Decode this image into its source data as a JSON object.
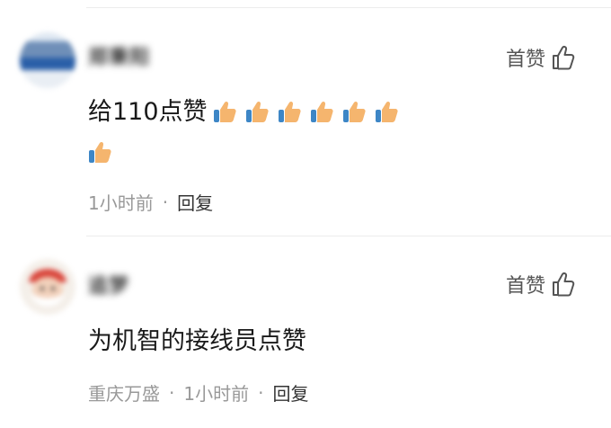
{
  "comments": [
    {
      "username": "郑秉阳",
      "like_label": "首赞",
      "text": "给110点赞",
      "emoji_count": 7,
      "time": "1小时前",
      "dot": "·",
      "reply_label": "回复"
    },
    {
      "username": "追梦",
      "like_label": "首赞",
      "text": "为机智的接线员点赞",
      "location": "重庆万盛",
      "time": "1小时前",
      "dot": "·",
      "reply_label": "回复"
    }
  ],
  "icons": {
    "like": "thumbs-up-outline-icon",
    "emoji": "thumbs-up-emoji"
  },
  "colors": {
    "meta": "#999999",
    "divider": "#ececec",
    "emoji_skin": "#f5b56e",
    "emoji_cuff": "#3d86c6"
  }
}
